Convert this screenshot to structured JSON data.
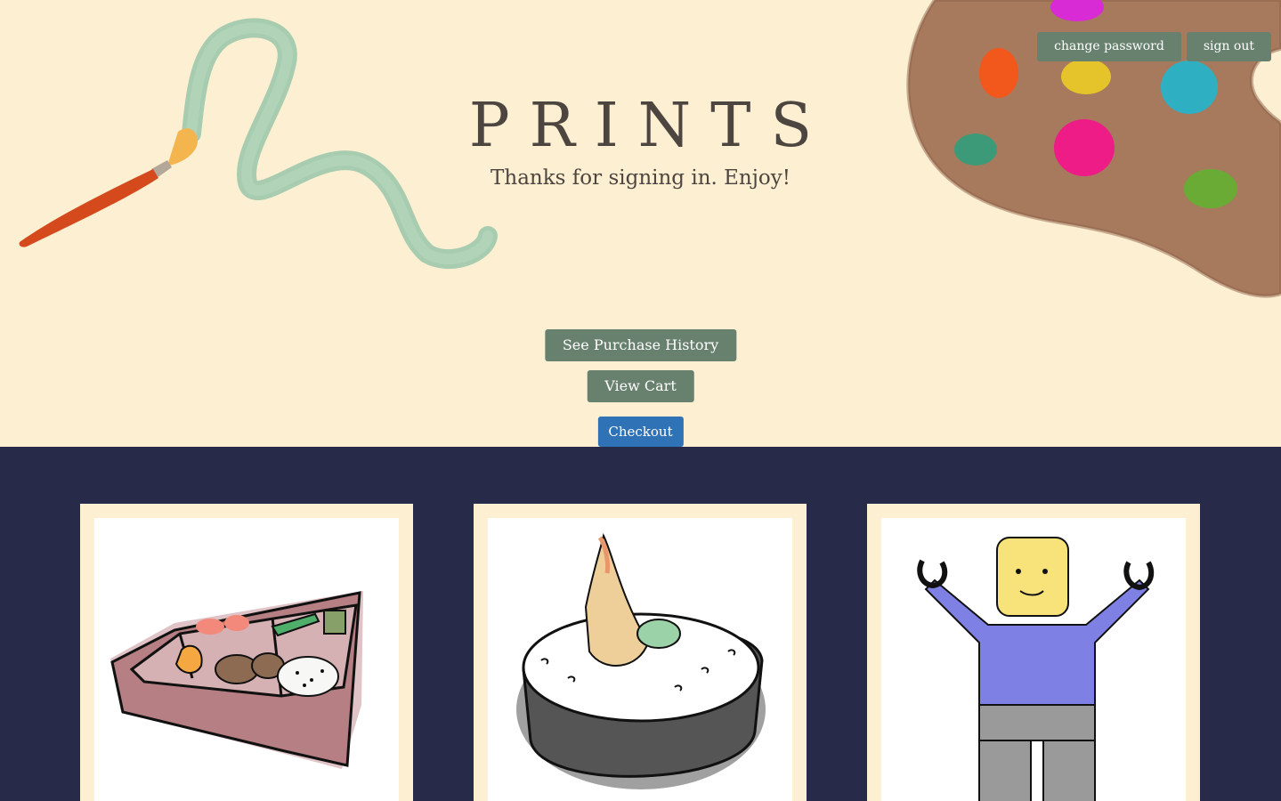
{
  "header": {
    "change_password_label": "change password",
    "sign_out_label": "sign out"
  },
  "hero": {
    "title": "PRINTS",
    "subtitle": "Thanks for signing in. Enjoy!"
  },
  "actions": {
    "purchase_history_label": "See Purchase History",
    "view_cart_label": "View Cart",
    "checkout_label": "Checkout"
  },
  "colors": {
    "background": "#fdefd2",
    "gallery_background": "#272b49",
    "button_green": "#68816f",
    "button_blue": "#2f73b6",
    "text_dark": "#4d4640"
  },
  "gallery": {
    "items": [
      {
        "icon": "bento-box-illustration"
      },
      {
        "icon": "shrimp-sushi-illustration"
      },
      {
        "icon": "lego-figure-illustration"
      }
    ]
  }
}
